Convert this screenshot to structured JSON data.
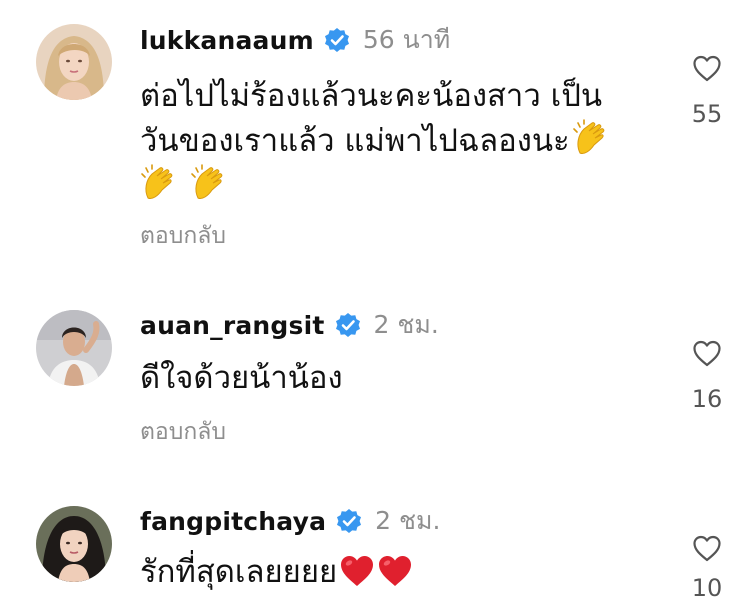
{
  "comments": [
    {
      "username": "lukkanaaum",
      "verified": true,
      "time": "56 นาที",
      "lines": [
        "ต่อไปไม่ร้องแล้วนะคะน้องสาว เป็น",
        "วันของเราแล้ว แม่พาไปฉลองนะ"
      ],
      "emojis": [
        "clapping-hands-emoji",
        "clapping-hands-emoji",
        "clapping-hands-emoji"
      ],
      "reply_label": "ตอบกลับ",
      "like_count": "55"
    },
    {
      "username": "auan_rangsit",
      "verified": true,
      "time": "2 ชม.",
      "lines": [
        "ดีใจด้วยน้าน้อง"
      ],
      "emojis": [],
      "reply_label": "ตอบกลับ",
      "like_count": "16"
    },
    {
      "username": "fangpitchaya",
      "verified": true,
      "time": "2 ชม.",
      "lines": [
        "รักที่สุดเลยยยย"
      ],
      "emojis": [
        "red-heart-emoji",
        "red-heart-emoji"
      ],
      "reply_label": "",
      "like_count": "10"
    }
  ],
  "colors": {
    "verified_badge": "#3897f0",
    "secondary_text": "#8e8e8e",
    "heart_emoji": "#e0202e",
    "clap_emoji": "#f7c21a"
  }
}
